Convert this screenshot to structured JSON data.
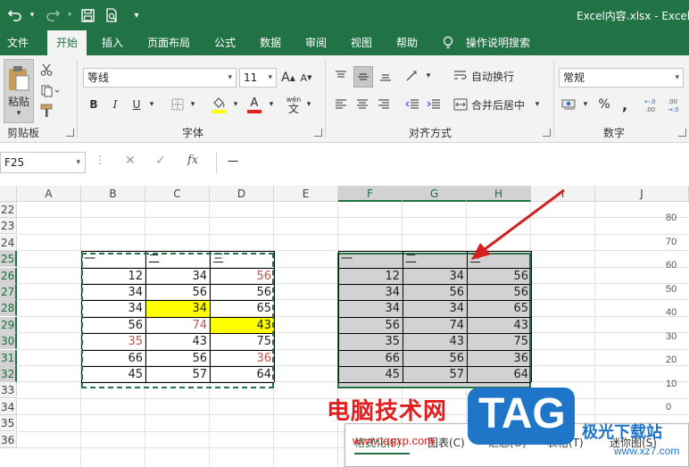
{
  "titlebar": {
    "title": "Excel内容.xlsx  -  Excel",
    "undo_icon": "undo-icon",
    "redo_icon": "redo-icon",
    "save_icon": "save-icon",
    "preview_icon": "print-preview-icon",
    "customize_icon": "customize-qat-icon"
  },
  "tabs": [
    "文件",
    "开始",
    "插入",
    "页面布局",
    "公式",
    "数据",
    "审阅",
    "视图",
    "帮助",
    "操作说明搜索"
  ],
  "active_tab": "开始",
  "ribbon": {
    "clipboard": {
      "label": "剪贴板",
      "paste": "粘贴"
    },
    "font": {
      "label": "字体",
      "font_name": "等线",
      "font_size": "11",
      "bold": "B",
      "italic": "I",
      "underline": "U",
      "grow": "A",
      "shrink": "A",
      "phonetic": "wén",
      "font_color_letter": "A",
      "highlight_color": "#ffff00",
      "font_color": "#e02020"
    },
    "alignment": {
      "label": "对齐方式",
      "wrap_text": "自动换行",
      "merge_center": "合并后居中"
    },
    "number": {
      "label": "数字",
      "format": "常规",
      "percent": "%",
      "comma": ","
    }
  },
  "formula_bar": {
    "name_box": "F25",
    "formula": "一",
    "fx": "fx"
  },
  "grid": {
    "columns": [
      "A",
      "B",
      "C",
      "D",
      "E",
      "F",
      "G",
      "H",
      "I",
      "J"
    ],
    "rows": [
      "22",
      "23",
      "24",
      "25",
      "26",
      "27",
      "28",
      "29",
      "30",
      "31",
      "32",
      "33",
      "34",
      "35",
      "36"
    ],
    "left_table": {
      "headers": [
        "一",
        "二",
        "三"
      ],
      "rows": [
        [
          "12",
          "34",
          "56"
        ],
        [
          "34",
          "56",
          "56"
        ],
        [
          "34",
          "34",
          "65"
        ],
        [
          "56",
          "74",
          "43"
        ],
        [
          "35",
          "43",
          "75"
        ],
        [
          "66",
          "56",
          "36"
        ],
        [
          "45",
          "57",
          "64"
        ]
      ]
    },
    "right_table": {
      "headers": [
        "一",
        "二",
        "三"
      ],
      "rows": [
        [
          "12",
          "34",
          "56"
        ],
        [
          "34",
          "56",
          "56"
        ],
        [
          "34",
          "34",
          "65"
        ],
        [
          "56",
          "74",
          "43"
        ],
        [
          "35",
          "43",
          "75"
        ],
        [
          "66",
          "56",
          "36"
        ],
        [
          "45",
          "57",
          "64"
        ]
      ]
    },
    "axis_labels": [
      "80",
      "70",
      "60",
      "50",
      "40",
      "30",
      "20",
      "10",
      "0"
    ]
  },
  "quick_analysis": {
    "tabs": [
      "格式化(F)",
      "图表(C)",
      "汇总(O)",
      "表格(T)",
      "迷你图(S)"
    ]
  },
  "watermark": {
    "text": "电脑技术网",
    "url": "www.tagxp.com",
    "tag": "TAG",
    "site": "极光下载站",
    "site_url": "www.xz7.com"
  },
  "colors": {
    "accent": "#217346",
    "highlight": "#ffff00",
    "red_text": "#c0504d",
    "arrow": "#d42020"
  }
}
